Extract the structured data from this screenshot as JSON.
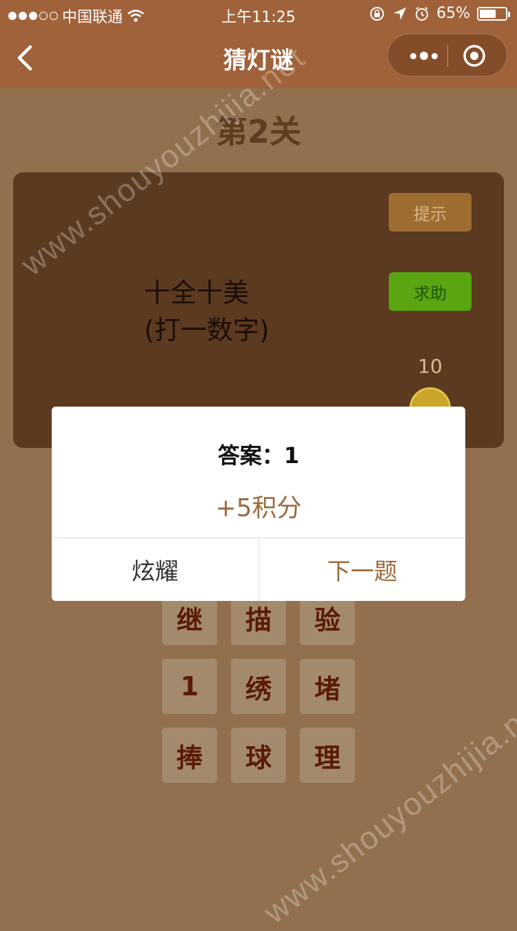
{
  "status_bar": {
    "carrier": "中国联通",
    "time": "上午11:25",
    "battery_percent": "65%",
    "battery_level": 0.65,
    "signal_dots_filled": 3,
    "signal_dots_total": 5
  },
  "nav": {
    "title": "猜灯谜",
    "back_icon": "chevron-left-icon",
    "more_icon": "more-dots-icon",
    "close_icon": "target-circle-icon"
  },
  "level": {
    "label": "第2关"
  },
  "riddle": {
    "line1": "十全十美",
    "line2": "(打一数字)"
  },
  "actions": {
    "hint": "提示",
    "help": "求助",
    "coins": "10"
  },
  "grid": {
    "rows": [
      [
        "继",
        "描",
        "验"
      ],
      [
        "1",
        "绣",
        "堵"
      ],
      [
        "捧",
        "球",
        "理"
      ]
    ]
  },
  "dialog": {
    "answer": "答案：1",
    "score": "+5积分",
    "show_off": "炫耀",
    "next": "下一题"
  },
  "watermark": "www.shouyouzhijia.net",
  "colors": {
    "nav_bg": "#a0623a",
    "page_bg": "#93704d",
    "card_bg": "#5c3a20",
    "hint_bg": "#9e6d30",
    "help_bg": "#5aa512",
    "accent_text": "#9a6a3d"
  }
}
